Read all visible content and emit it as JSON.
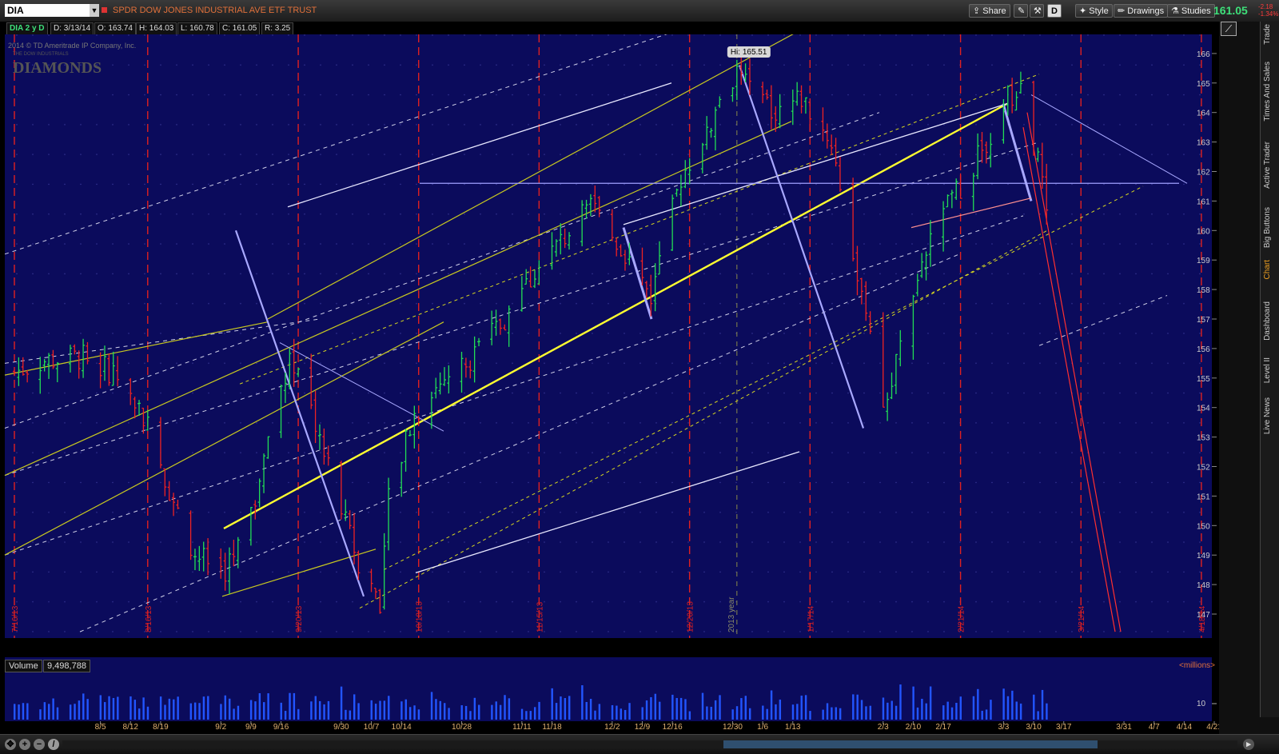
{
  "toolbar": {
    "symbol": "DIA",
    "symbol_name": "SPDR DOW JONES INDUSTRIAL AVE ETF TRUST",
    "share_label": "Share",
    "period_label": "D",
    "style_label": "Style",
    "drawings_label": "Drawings",
    "studies_label": "Studies",
    "last_price": "161.05",
    "change_abs": "-2.18",
    "change_pct": "-1.34%"
  },
  "info": {
    "symbol_period": "DIA 2 y D",
    "date": "D: 3/13/14",
    "open": "O: 163.74",
    "high": "H: 164.03",
    "low": "L: 160.78",
    "close": "C: 161.05",
    "range": "R: 3.25"
  },
  "watermark": {
    "copyright": "2014 © TD Ameritrade IP Company, Inc.",
    "tagline": "THE DOW INDUSTRIALS",
    "brand": "DIAMONDS"
  },
  "side_tabs": [
    "Trade",
    "Times And Sales",
    "Active Trader",
    "Big Buttons",
    "Chart",
    "Dashboard",
    "Level II",
    "Live News"
  ],
  "volume": {
    "label": "Volume",
    "value": "9,498,788",
    "unit": "<millions>",
    "tick_10": "10"
  },
  "colors": {
    "background": "#0b0b5c",
    "up_bar": "#22dd55",
    "down_bar": "#ee2222",
    "volume_bar": "#2255ff",
    "month_marker": "#e02020",
    "price_tag": "#e02020"
  },
  "chart_data": {
    "type": "ohlc",
    "y_ticks": [
      147,
      148,
      149,
      150,
      151,
      152,
      153,
      154,
      155,
      156,
      157,
      158,
      159,
      160,
      161,
      162,
      163,
      164,
      165,
      166
    ],
    "ylim": [
      146.4,
      166.6
    ],
    "hi_label": "Hi: 165.51",
    "hi_value": 165.51,
    "last_price": 161.05,
    "x_tick_labels": [
      "8/5",
      "8/12",
      "8/19",
      "9/2",
      "9/9",
      "9/16",
      "9/30",
      "10/7",
      "10/14",
      "10/28",
      "11/11",
      "11/18",
      "12/2",
      "12/9",
      "12/16",
      "12/30",
      "1/6",
      "1/13",
      "2/3",
      "2/10",
      "2/17",
      "3/3",
      "3/10",
      "3/17",
      "3/31",
      "4/7",
      "4/14",
      "4/21"
    ],
    "month_markers": [
      "7/16/13",
      "8/16/13",
      "9/20/13",
      "10/18/13",
      "11/15/13",
      "12/20/13",
      "1/17/14",
      "2/21/14",
      "3/21/14",
      "4/18/14"
    ],
    "year_marker": "2013 year",
    "price_path": [
      {
        "d": "7/16",
        "c": 155.2
      },
      {
        "d": "7/23",
        "c": 155.6
      },
      {
        "d": "8/1",
        "c": 155.7
      },
      {
        "d": "8/8",
        "c": 155.2
      },
      {
        "d": "8/15",
        "c": 153.8
      },
      {
        "d": "8/21",
        "c": 151.2
      },
      {
        "d": "8/27",
        "c": 149.0
      },
      {
        "d": "9/3",
        "c": 148.5
      },
      {
        "d": "9/9",
        "c": 150.2
      },
      {
        "d": "9/13",
        "c": 153.0
      },
      {
        "d": "9/18",
        "c": 155.8
      },
      {
        "d": "9/24",
        "c": 153.5
      },
      {
        "d": "9/30",
        "c": 150.5
      },
      {
        "d": "10/4",
        "c": 148.8
      },
      {
        "d": "10/9",
        "c": 147.5
      },
      {
        "d": "10/11",
        "c": 150.8
      },
      {
        "d": "10/17",
        "c": 153.8
      },
      {
        "d": "10/24",
        "c": 155.0
      },
      {
        "d": "10/31",
        "c": 155.8
      },
      {
        "d": "11/7",
        "c": 157.0
      },
      {
        "d": "11/14",
        "c": 158.6
      },
      {
        "d": "11/21",
        "c": 159.8
      },
      {
        "d": "11/27",
        "c": 160.8
      },
      {
        "d": "12/4",
        "c": 159.5
      },
      {
        "d": "12/11",
        "c": 157.8
      },
      {
        "d": "12/18",
        "c": 161.8
      },
      {
        "d": "12/26",
        "c": 164.0
      },
      {
        "d": "12/31",
        "c": 165.5
      },
      {
        "d": "1/8",
        "c": 164.0
      },
      {
        "d": "1/15",
        "c": 164.5
      },
      {
        "d": "1/22",
        "c": 163.0
      },
      {
        "d": "1/28",
        "c": 158.5
      },
      {
        "d": "2/3",
        "c": 154.0
      },
      {
        "d": "2/6",
        "c": 155.5
      },
      {
        "d": "2/12",
        "c": 159.0
      },
      {
        "d": "2/18",
        "c": 160.8
      },
      {
        "d": "2/25",
        "c": 162.5
      },
      {
        "d": "3/4",
        "c": 164.5
      },
      {
        "d": "3/7",
        "c": 164.7
      },
      {
        "d": "3/13",
        "c": 161.05
      }
    ]
  }
}
